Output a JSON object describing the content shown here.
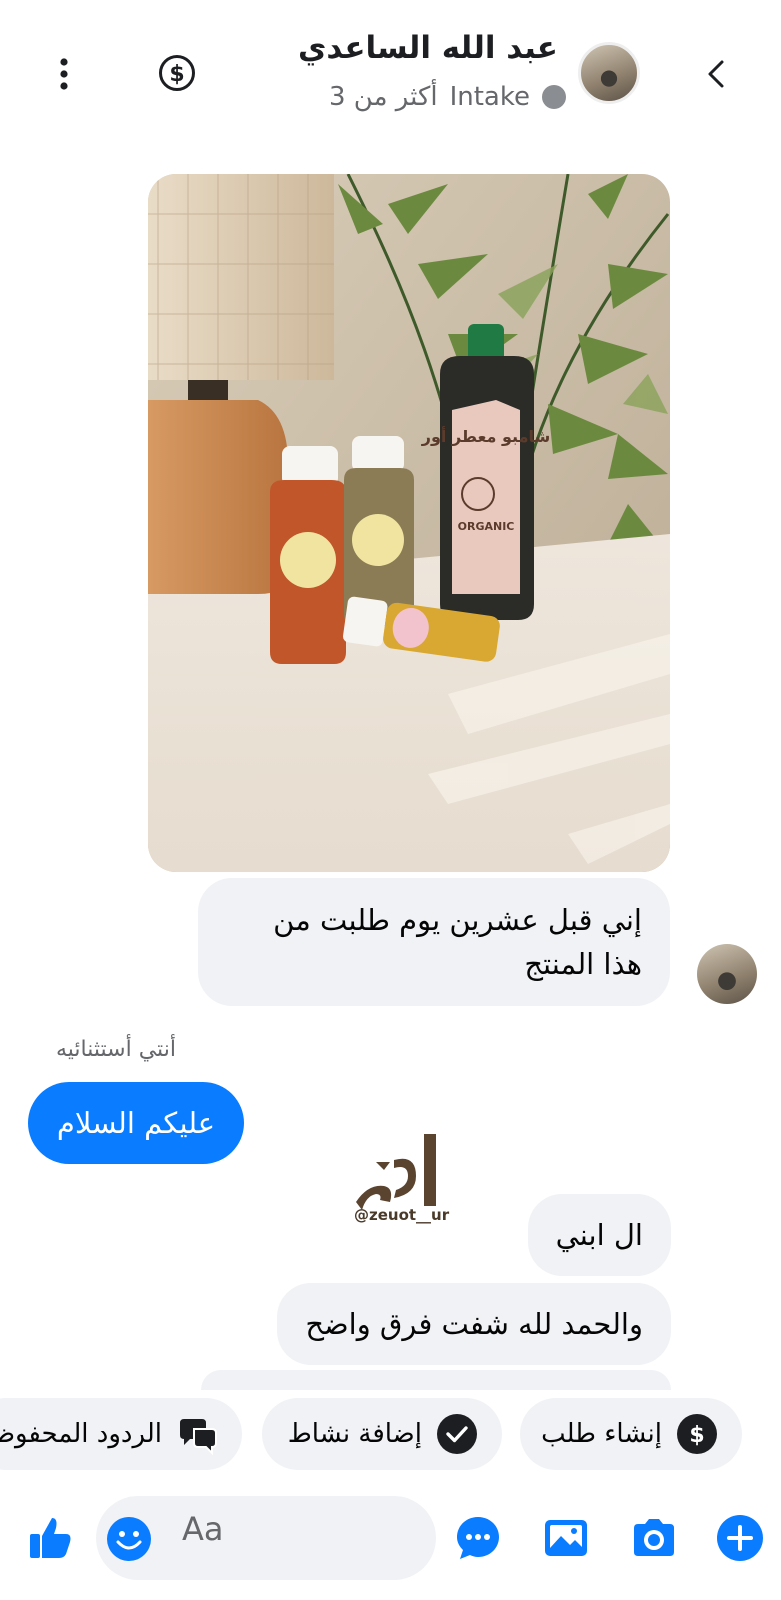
{
  "header": {
    "contact_name": "عبد الله الساعدي",
    "status_label": "Intake",
    "status_time": "أكثر من 3"
  },
  "messages": {
    "incoming_1": "إني قبل عشرين يوم طلبت من هذا المنتج",
    "reply_to_label": "أنتي أستثنائيه",
    "outgoing_1": "عليكم السلام",
    "incoming_2": "ال ابني",
    "incoming_3": "والحمد لله شفت فرق واضح"
  },
  "watermark": {
    "handle": "@zeuot__ur",
    "logo_text": "أور"
  },
  "product_photo": {
    "big_bottle_label": "شامبو معطر أور",
    "big_bottle_sub": "ORGANIC"
  },
  "quick_actions": [
    {
      "label": "إنشاء طلب",
      "icon": "dollar-icon"
    },
    {
      "label": "إضافة نشاط",
      "icon": "check-circle-icon"
    },
    {
      "label": "الردود المحفوظة",
      "icon": "chat-bubbles-icon"
    }
  ],
  "composer": {
    "placeholder": "Aa"
  },
  "colors": {
    "accent": "#0a7cff",
    "bubble_incoming": "#f0f2f5",
    "text_secondary": "#65676b"
  }
}
